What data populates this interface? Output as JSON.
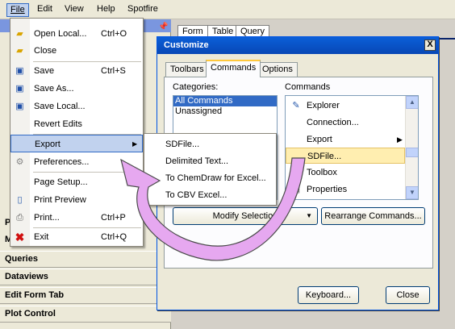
{
  "menubar": {
    "items": [
      {
        "label": "File"
      },
      {
        "label": "Edit"
      },
      {
        "label": "View"
      },
      {
        "label": "Help"
      },
      {
        "label": "Spotfire"
      }
    ]
  },
  "left_pane": {
    "sections": [
      {
        "label": "Queries"
      },
      {
        "label": "Dataviews"
      },
      {
        "label": "Edit Form Tab"
      },
      {
        "label": "Plot Control"
      }
    ],
    "stubs": [
      "P",
      "M"
    ]
  },
  "app_tabs": [
    {
      "label": "Form"
    },
    {
      "label": "Table"
    },
    {
      "label": "Query"
    }
  ],
  "file_menu": {
    "items": [
      {
        "label": "Open Local...",
        "shortcut": "Ctrl+O",
        "icon": "folder-open-icon"
      },
      {
        "label": "Close",
        "shortcut": "",
        "icon": "folder-close-icon"
      },
      {
        "label": "Save",
        "shortcut": "Ctrl+S",
        "icon": "floppy-disk-icon"
      },
      {
        "label": "Save As...",
        "shortcut": "",
        "icon": "floppy-disk-icon"
      },
      {
        "label": "Save Local...",
        "shortcut": "",
        "icon": "floppy-disk-icon"
      },
      {
        "label": "Revert Edits",
        "shortcut": "",
        "icon": ""
      },
      {
        "label": "Export",
        "shortcut": "",
        "icon": ""
      },
      {
        "label": "Preferences...",
        "shortcut": "",
        "icon": "gear-icon"
      },
      {
        "label": "Page Setup...",
        "shortcut": "",
        "icon": ""
      },
      {
        "label": "Print Preview",
        "shortcut": "",
        "icon": "print-preview-icon"
      },
      {
        "label": "Print...",
        "shortcut": "Ctrl+P",
        "icon": "printer-icon"
      },
      {
        "label": "Exit",
        "shortcut": "Ctrl+Q",
        "icon": "red-x-icon"
      }
    ]
  },
  "export_submenu": {
    "items": [
      {
        "label": "SDFile..."
      },
      {
        "label": "Delimited Text..."
      },
      {
        "label": "To ChemDraw for Excel..."
      },
      {
        "label": "To CBV Excel..."
      }
    ]
  },
  "dialog": {
    "title": "Customize",
    "close_glyph": "X",
    "tabs": [
      {
        "label": "Toolbars"
      },
      {
        "label": "Commands"
      },
      {
        "label": "Options"
      }
    ],
    "categories_label": "Categories:",
    "categories": [
      "All Commands",
      "Unassigned"
    ],
    "commands_label": "Commands",
    "commands": [
      {
        "label": "Explorer",
        "icon": "explorer-icon"
      },
      {
        "label": "Connection...",
        "icon": ""
      },
      {
        "label": "Export",
        "icon": ""
      },
      {
        "label": "SDFile...",
        "icon": ""
      },
      {
        "label": "Toolbox",
        "icon": "toolbox-icon"
      },
      {
        "label": "Properties",
        "icon": "properties-icon"
      }
    ],
    "modify_selection_label": "Modify Selection",
    "rearrange_label": "Rearrange Commands...",
    "keyboard_label": "Keyboard...",
    "close_label": "Close"
  },
  "colors": {
    "title_blue": "#0a5fd8",
    "highlight_blue": "#316ac5",
    "selection_yellow": "#ffeeb0",
    "arrow_fill": "#e6a8f0"
  }
}
